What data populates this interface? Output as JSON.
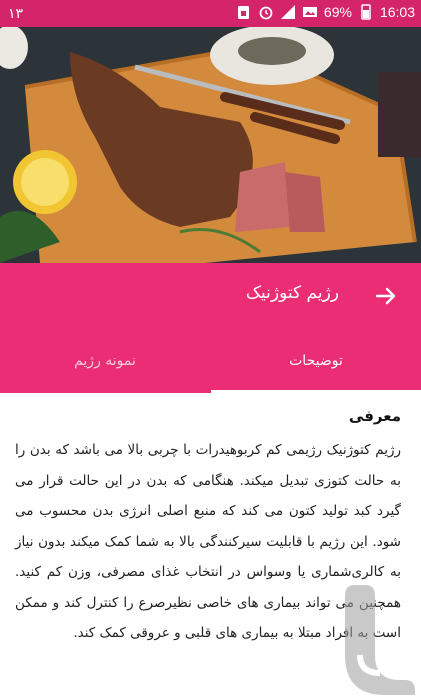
{
  "status_bar": {
    "time": "16:03",
    "battery": "69%",
    "notification_count": "١٣",
    "icons": [
      "battery-icon",
      "image-icon",
      "signal-icon",
      "alarm-icon",
      "sim-icon"
    ]
  },
  "app_bar": {
    "title": "رژیم کتوژنیک",
    "back_icon": "arrow-right-icon"
  },
  "tabs": [
    {
      "label": "توضیحات",
      "selected": true
    },
    {
      "label": "نمونه رژیم",
      "selected": false
    }
  ],
  "content": {
    "heading": "معرفی",
    "body": "رژیم کتوژنیک رژیمی کم کربوهیدرات با چربی بالا می باشد که بدن را به حالت کتوزی تبدیل میکند. هنگامی که بدن در این حالت قرار می گیرد کبد تولید کتون می کند که منبع اصلی انرژی بدن محسوب می شود. این رژیم با قابلیت سیرکنندگی بالا به شما کمک میکند بدون نیاز به کالری‌شماری یا وسواس در انتخاب غذای مصرفی، وزن کم کنید. همچنین می تواند بیماری های خاصی نظیرصرع را کنترل کند و ممکن است به افراد مبتلا به بیماری های قلبی و عروقی کمک کند."
  },
  "colors": {
    "accent": "#ea2d75",
    "status_bar": "#d4256a",
    "tab_inactive_text": "#f9c9da"
  }
}
